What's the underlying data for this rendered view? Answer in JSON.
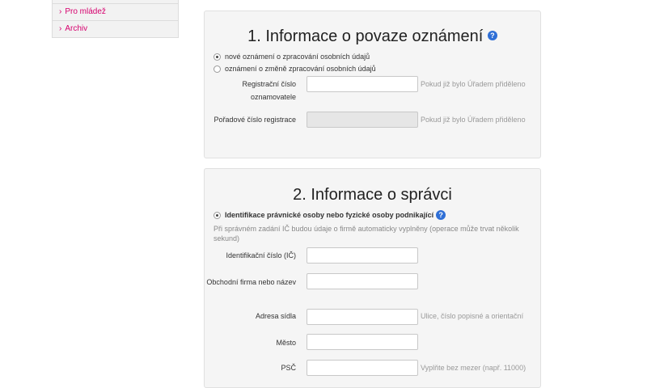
{
  "sidebar": {
    "items": [
      {
        "label": "Pro mládež"
      },
      {
        "label": "Archiv"
      }
    ]
  },
  "section1": {
    "title": "1. Informace o povaze oznámení",
    "radios": [
      {
        "label": "nové oznámení o zpracování osobních údajů",
        "checked": true
      },
      {
        "label": "oznámení o změně zpracování osobních údajů",
        "checked": false
      }
    ],
    "fields": [
      {
        "label": "Registrační číslo oznamovatele",
        "value": "",
        "hint": "Pokud již bylo Úřadem přiděleno",
        "disabled": false
      },
      {
        "label": "Pořadové číslo registrace",
        "value": "",
        "hint": "Pokud již bylo Úřadem přiděleno",
        "disabled": true
      }
    ]
  },
  "section2": {
    "title": "2. Informace o správci",
    "radio_label": "Identifikace právnické osoby nebo fyzické osoby podnikající",
    "note": "Při správném zadání IČ budou údaje o firmě automaticky vyplněny (operace může trvat několik sekund)",
    "fields": [
      {
        "label": "Identifikační číslo (IČ)",
        "value": "",
        "hint": ""
      },
      {
        "label": "Obchodní firma nebo název",
        "value": "",
        "hint": ""
      },
      {
        "label": "Adresa sídla",
        "value": "",
        "hint": "Ulice, číslo popisné a orientační"
      },
      {
        "label": "Město",
        "value": "",
        "hint": ""
      },
      {
        "label": "PSČ",
        "value": "",
        "hint": "Vyplňte bez mezer (např. 11000)"
      }
    ]
  },
  "colors": {
    "accent": "#d6006e",
    "help": "#2f6fd6"
  },
  "icons": {
    "help": "question-mark",
    "chevron": "chevron-right"
  }
}
